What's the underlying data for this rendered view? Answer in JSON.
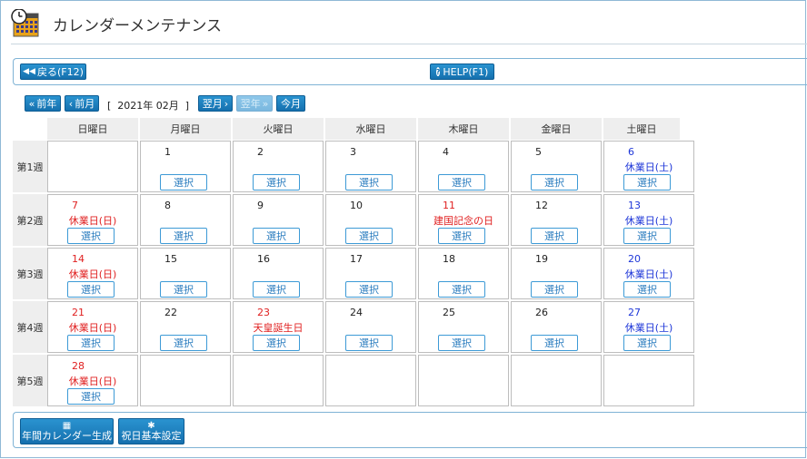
{
  "header": {
    "title": "カレンダーメンテナンス"
  },
  "toolbar": {
    "back_label": "戻る(F12)",
    "help_label": "HELP(F1)"
  },
  "nav": {
    "prev_year_label": "前年",
    "prev_month_label": "前月",
    "month_label": "[  2021年 02月  ]",
    "next_month_label": "翌月",
    "next_year_label": "翌年",
    "today_label": "今月"
  },
  "calendar": {
    "weekdays": [
      "日曜日",
      "月曜日",
      "火曜日",
      "水曜日",
      "木曜日",
      "金曜日",
      "土曜日"
    ],
    "weeks": [
      {
        "label": "第1週",
        "days": [
          {
            "day": "",
            "holiday": "",
            "type": "",
            "select": false
          },
          {
            "day": "1",
            "holiday": "",
            "type": "",
            "select": true
          },
          {
            "day": "2",
            "holiday": "",
            "type": "",
            "select": true
          },
          {
            "day": "3",
            "holiday": "",
            "type": "",
            "select": true
          },
          {
            "day": "4",
            "holiday": "",
            "type": "",
            "select": true
          },
          {
            "day": "5",
            "holiday": "",
            "type": "",
            "select": true
          },
          {
            "day": "6",
            "holiday": "休業日(土)",
            "type": "saturday",
            "select": true
          }
        ]
      },
      {
        "label": "第2週",
        "days": [
          {
            "day": "7",
            "holiday": "休業日(日)",
            "type": "sunday",
            "select": true
          },
          {
            "day": "8",
            "holiday": "",
            "type": "",
            "select": true
          },
          {
            "day": "9",
            "holiday": "",
            "type": "",
            "select": true
          },
          {
            "day": "10",
            "holiday": "",
            "type": "",
            "select": true
          },
          {
            "day": "11",
            "holiday": "建国記念の日",
            "type": "holiday",
            "select": true
          },
          {
            "day": "12",
            "holiday": "",
            "type": "",
            "select": true
          },
          {
            "day": "13",
            "holiday": "休業日(土)",
            "type": "saturday",
            "select": true
          }
        ]
      },
      {
        "label": "第3週",
        "days": [
          {
            "day": "14",
            "holiday": "休業日(日)",
            "type": "sunday",
            "select": true
          },
          {
            "day": "15",
            "holiday": "",
            "type": "",
            "select": true
          },
          {
            "day": "16",
            "holiday": "",
            "type": "",
            "select": true
          },
          {
            "day": "17",
            "holiday": "",
            "type": "",
            "select": true
          },
          {
            "day": "18",
            "holiday": "",
            "type": "",
            "select": true
          },
          {
            "day": "19",
            "holiday": "",
            "type": "",
            "select": true
          },
          {
            "day": "20",
            "holiday": "休業日(土)",
            "type": "saturday",
            "select": true
          }
        ]
      },
      {
        "label": "第4週",
        "days": [
          {
            "day": "21",
            "holiday": "休業日(日)",
            "type": "sunday",
            "select": true
          },
          {
            "day": "22",
            "holiday": "",
            "type": "",
            "select": true
          },
          {
            "day": "23",
            "holiday": "天皇誕生日",
            "type": "holiday",
            "select": true
          },
          {
            "day": "24",
            "holiday": "",
            "type": "",
            "select": true
          },
          {
            "day": "25",
            "holiday": "",
            "type": "",
            "select": true
          },
          {
            "day": "26",
            "holiday": "",
            "type": "",
            "select": true
          },
          {
            "day": "27",
            "holiday": "休業日(土)",
            "type": "saturday",
            "select": true
          }
        ]
      },
      {
        "label": "第5週",
        "days": [
          {
            "day": "28",
            "holiday": "休業日(日)",
            "type": "sunday",
            "select": true
          },
          {
            "day": "",
            "holiday": "",
            "type": "",
            "select": false
          },
          {
            "day": "",
            "holiday": "",
            "type": "",
            "select": false
          },
          {
            "day": "",
            "holiday": "",
            "type": "",
            "select": false
          },
          {
            "day": "",
            "holiday": "",
            "type": "",
            "select": false
          },
          {
            "day": "",
            "holiday": "",
            "type": "",
            "select": false
          },
          {
            "day": "",
            "holiday": "",
            "type": "",
            "select": false
          }
        ]
      }
    ],
    "select_label": "選択"
  },
  "bottom": {
    "annual_calendar_label": "年間カレンダー生成",
    "holiday_settings_label": "祝日基本設定"
  },
  "colors": {
    "accent": "#1a7dc0",
    "sunday_red": "#e02020",
    "saturday_blue": "#1d36d8",
    "border": "#7fb3d5"
  }
}
